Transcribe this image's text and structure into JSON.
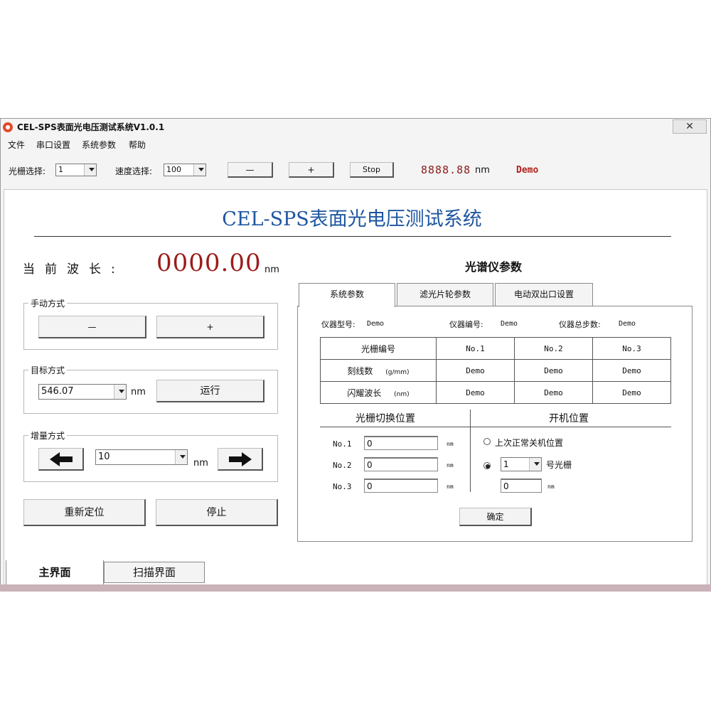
{
  "window": {
    "title": "CEL-SPS表面光电压测试系统V1.0.1",
    "close_label": "✕"
  },
  "menu": [
    "文件",
    "串口设置",
    "系统参数",
    "帮助"
  ],
  "toolbar": {
    "grating_label": "光栅选择:",
    "grating_value": "1",
    "speed_label": "速度选择:",
    "speed_value": "100",
    "minus_label": "—",
    "plus_label": "+",
    "stop_label": "Stop",
    "wavelength_display": "8888.88",
    "wavelength_unit": "nm",
    "demo_label": "Demo"
  },
  "main": {
    "title": "CEL-SPS表面光电压测试系统",
    "current_wavelength_label": "当前波长:",
    "current_wavelength_value": "0000.00",
    "current_wavelength_unit": "nm",
    "manual": {
      "title": "手动方式",
      "minus_label": "—",
      "plus_label": "+"
    },
    "target": {
      "title": "目标方式",
      "value": "546.07",
      "unit": "nm",
      "run_label": "运行"
    },
    "increment": {
      "title": "增量方式",
      "value": "10",
      "unit": "nm"
    },
    "reposition_label": "重新定位",
    "stop_label": "停止"
  },
  "spectrometer": {
    "title": "光谱仪参数",
    "tabs": [
      "系统参数",
      "滤光片轮参数",
      "电动双出口设置"
    ],
    "model_label": "仪器型号:",
    "model_value": "Demo",
    "serial_label": "仪器编号:",
    "serial_value": "Demo",
    "steps_label": "仪器总步数:",
    "steps_value": "Demo",
    "table": {
      "headers": [
        "光栅编号",
        "No.1",
        "No.2",
        "No.3"
      ],
      "rows": [
        {
          "label": "刻线数",
          "unit": "(g/mm)",
          "values": [
            "Demo",
            "Demo",
            "Demo"
          ]
        },
        {
          "label": "闪耀波长",
          "unit": "(nm)",
          "values": [
            "Demo",
            "Demo",
            "Demo"
          ]
        }
      ]
    },
    "switch_title": "光栅切换位置",
    "switch_rows": [
      {
        "label": "No.1",
        "value": "0",
        "unit": "nm"
      },
      {
        "label": "No.2",
        "value": "0",
        "unit": "nm"
      },
      {
        "label": "No.3",
        "value": "0",
        "unit": "nm"
      }
    ],
    "startup_title": "开机位置",
    "startup_option1": "上次正常关机位置",
    "startup_grating_value": "1",
    "startup_grating_suffix": "号光栅",
    "startup_position_value": "0",
    "startup_position_unit": "nm",
    "confirm_label": "确定"
  },
  "bottom_tabs": [
    "主界面",
    "扫描界面"
  ]
}
